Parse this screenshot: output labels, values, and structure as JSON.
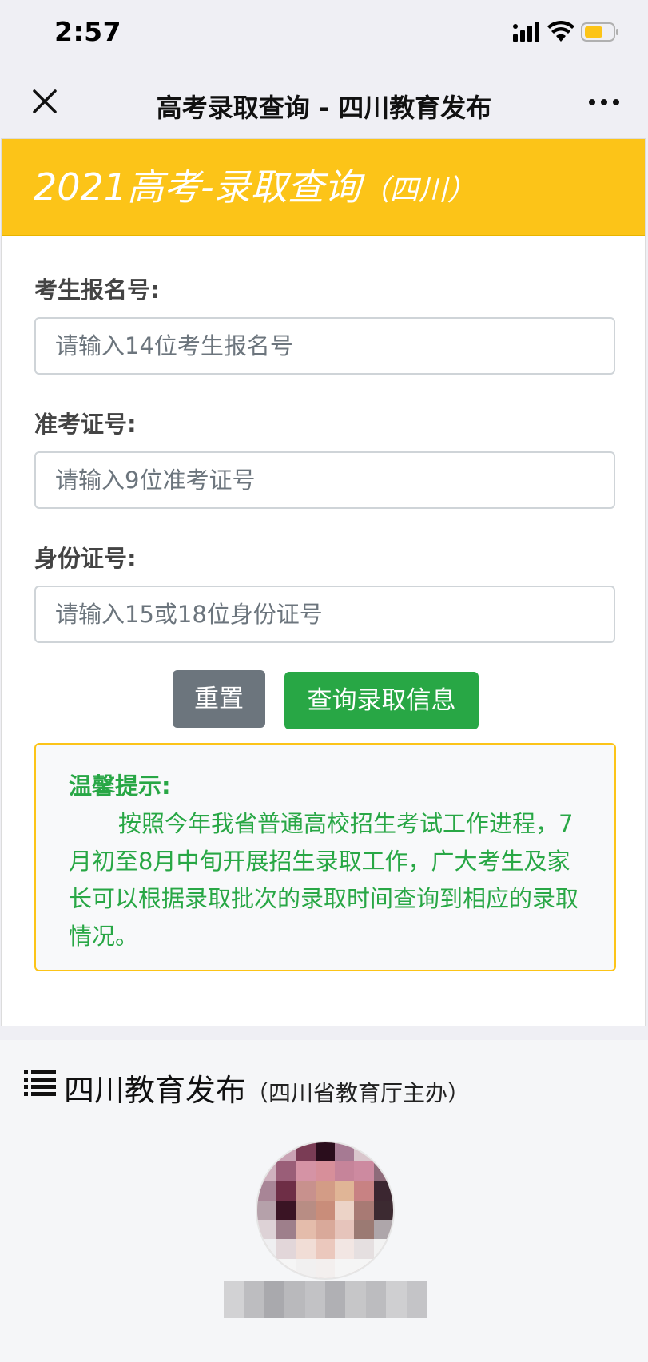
{
  "status_bar": {
    "time": "2:57"
  },
  "nav": {
    "title": "高考录取查询 - 四川教育发布"
  },
  "header": {
    "title": "2021高考-录取查询",
    "subtitle": "（四川）"
  },
  "form": {
    "fields": [
      {
        "label": "考生报名号:",
        "placeholder": "请输入14位考生报名号",
        "value": ""
      },
      {
        "label": "准考证号:",
        "placeholder": "请输入9位准考证号",
        "value": ""
      },
      {
        "label": "身份证号:",
        "placeholder": "请输入15或18位身份证号",
        "value": ""
      }
    ],
    "reset_label": "重置",
    "submit_label": "查询录取信息"
  },
  "tip": {
    "title": "温馨提示:",
    "body": "按照今年我省普通高校招生考试工作进程，7月初至8月中旬开展招生录取工作，广大考生及家长可以根据录取批次的录取时间查询到相应的录取情况。"
  },
  "footer": {
    "title": "四川教育发布",
    "subtitle": "（四川省教育厅主办）"
  },
  "colors": {
    "header_bg": "#fcc418",
    "submit_button": "#28a745",
    "reset_button": "#6c757d",
    "tip_text": "#28a745",
    "tip_border": "#fcc418"
  }
}
